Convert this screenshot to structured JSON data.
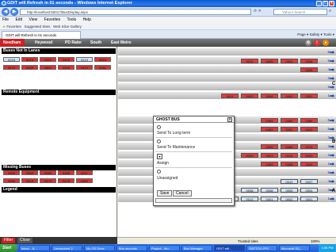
{
  "window": {
    "title": "GDIT will Refresh in 01 seconds - Windows Internet Explorer"
  },
  "address": {
    "url": "http://localhost:50017/BusDisplay.aspx",
    "search_placeholder": "Yahoo! Search"
  },
  "menu": [
    "File",
    "Edit",
    "View",
    "Favorites",
    "Tools",
    "Help"
  ],
  "favorites": {
    "label": "Favorites",
    "items": [
      "Suggested Sites",
      "Web Slice Gallery"
    ]
  },
  "tab": {
    "title": "GDIT will Refresh in 01 seconds",
    "tools": "Page ▾  Safety ▾  Tools ▾"
  },
  "appnav": {
    "items": [
      "Needham",
      "Heywood",
      "PD Rater",
      "South",
      "East Metro"
    ],
    "active": 0
  },
  "left": {
    "not_in_lanes": {
      "title": "Buses Not In Lanes",
      "chips": [
        "0018",
        "0213",
        "0419",
        "0422",
        "0419",
        "0453",
        "0473",
        "0439",
        "0402",
        "0494",
        "0470",
        "0461"
      ]
    },
    "remote": {
      "title": "Remote Equipment"
    },
    "missing": {
      "title": "Missing Buses",
      "chips": [
        "0390",
        "0363",
        "0388",
        "0395",
        "0211",
        "0459",
        "0418",
        "0475",
        "0478",
        "0383"
      ]
    },
    "legend": {
      "title": "Legend"
    },
    "filter": {
      "filter_label": "Filter",
      "close_label": "Close"
    }
  },
  "lanes": [
    {
      "num": "6",
      "tags": []
    },
    {
      "num": "5",
      "tags": [
        "0311",
        "0405",
        "0341",
        "0346"
      ]
    },
    {
      "num": "4",
      "tags": [
        "0406"
      ]
    },
    {
      "num": "3",
      "tags": []
    },
    {
      "num": "2",
      "tags": []
    },
    {
      "num": "1",
      "tags": [
        "0411",
        "0453",
        "0408",
        "0405",
        "0391"
      ]
    },
    {
      "num": "6",
      "tags": [
        "0454",
        "0480",
        "0484"
      ]
    },
    {
      "num": "5",
      "tags": [
        "0402",
        "0420",
        "0441"
      ]
    },
    {
      "num": "4",
      "tags": []
    },
    {
      "num": "3",
      "tags": [
        "0495",
        "0466",
        "0476"
      ]
    },
    {
      "num": "2",
      "tags": [
        "0426",
        "0423",
        "0414",
        "0439"
      ]
    },
    {
      "num": "1",
      "tags": [
        "0455",
        "0408",
        "0434"
      ]
    },
    {
      "num": "5",
      "tags": []
    },
    {
      "num": "4",
      "tags": [
        "0012",
        "0037"
      ]
    },
    {
      "num": "3",
      "tags": [
        "0008",
        "0008",
        "0005",
        "0004"
      ]
    },
    {
      "num": "1",
      "tags": [
        "0003",
        "0002",
        "0030",
        "0012",
        "0001",
        "0002",
        "0001"
      ]
    }
  ],
  "side_labels": [
    "C",
    "B",
    "A"
  ],
  "dialog": {
    "title": "GHOST BUS",
    "close": "X",
    "opt_long_term": "Send To Long term",
    "opt_maintenance": "Send To Maintenance",
    "opt_assign": "Assign",
    "opt_unassigned": "Unassigned",
    "assign_value": "0408",
    "save_label": "Save",
    "cancel_label": "Cancel"
  },
  "status": {
    "left": "Done",
    "zone": "Trusted sites",
    "zoom": "100%"
  },
  "taskbar": {
    "start": "Start",
    "tasks": [
      "Inbox - Ji...",
      "Unresolved 2",
      "My GS Drive",
      "Bus seconds",
      "Project - Mo...",
      "Bus Manager",
      "GDIT will...",
      "SKETCH.JPG",
      "Microsoft SQ..."
    ],
    "active_task": 6,
    "clock": "1:56 PM"
  },
  "colors": {
    "red": "#e53a3a",
    "blue": "#d4e6fb",
    "nav_active": "#cc2222"
  }
}
